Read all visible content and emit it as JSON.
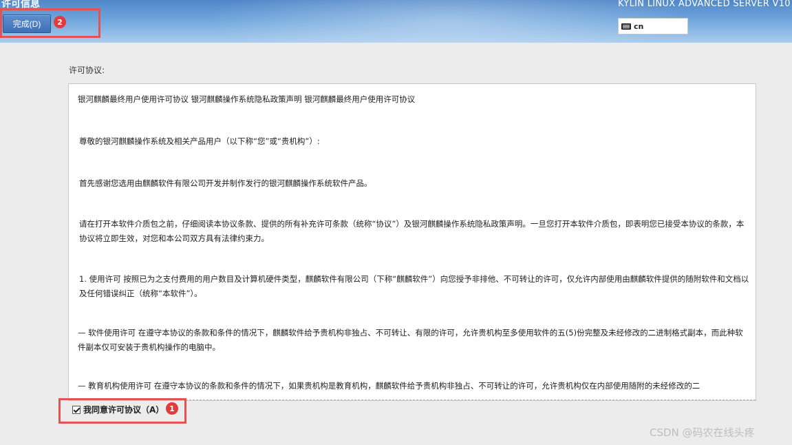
{
  "header": {
    "title": "许可信息",
    "done_button_label": "完成(D)",
    "product_name": "KYLIN LINUX ADVANCED SERVER V10",
    "keyboard_layout": "cn"
  },
  "annotations": {
    "marker_1": "1",
    "marker_2": "2",
    "color": "#e25454"
  },
  "license": {
    "label": "许可协议:",
    "paragraphs": [
      "银河麒麟最终用户使用许可协议 银河麒麟操作系统隐私政策声明 银河麒麟最终用户使用许可协议",
      "尊敬的银河麒麟操作系统及相关产品用户（以下称“您”或“贵机构”）:",
      "首先感谢您选用由麒麟软件有限公司开发并制作发行的银河麒麟操作系统软件产品。",
      "请在打开本软件介质包之前，仔细阅读本协议条款、提供的所有补充许可条款（统称“协议”）及银河麒麟操作系统隐私政策声明。一旦您打开本软件介质包，即表明您已接受本协议的条款，本协议将立即生效，对您和本公司双方具有法律约束力。",
      "1. 使用许可 按照已为之支付费用的用户数目及计算机硬件类型，麒麟软件有限公司（下称“麒麟软件”）向您授予非排他、不可转让的许可，仅允许内部使用由麒麟软件提供的随附软件和文档以及任何错误纠正（统称“本软件”）。",
      "— 软件使用许可 在遵守本协议的条款和条件的情况下，麒麟软件给予贵机构非独占、不可转让、有限的许可，允许贵机构至多使用软件的五(5)份完整及未经修改的二进制格式副本，而此种软件副本仅可安装于贵机构操作的电脑中。",
      "— 教育机构使用许可 在遵守本协议的条款和条件的情况下，如果贵机构是教育机构，麒麟软件给予贵机构非独占、不可转让的许可，允许贵机构仅在内部使用随附的未经修改的二"
    ],
    "agree_checked": true,
    "agree_label": "我同意许可协议（A）"
  },
  "watermark": "CSDN @码农在线头疼"
}
